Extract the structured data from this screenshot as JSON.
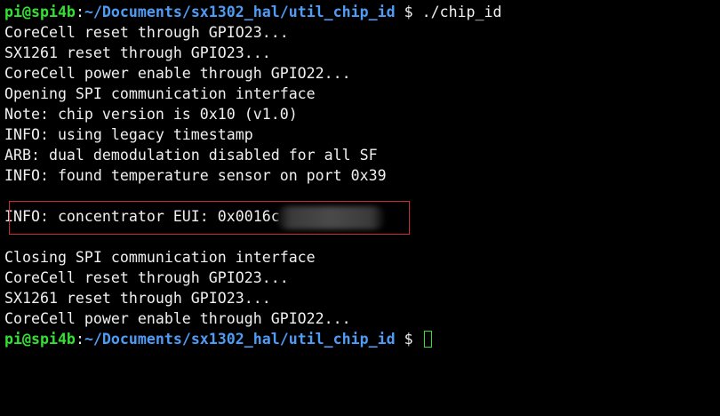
{
  "prompt": {
    "user_host": "pi@spi4b",
    "separator": ":",
    "path": "~/Documents/sx1302_hal/util_chip_id",
    "symbol": " $ ",
    "command": "./chip_id"
  },
  "output_before": [
    "CoreCell reset through GPIO23...",
    "SX1261 reset through GPIO23...",
    "CoreCell power enable through GPIO22...",
    "Opening SPI communication interface",
    "Note: chip version is 0x10 (v1.0)",
    "INFO: using legacy timestamp",
    "ARB: dual demodulation disabled for all SF",
    "INFO: found temperature sensor on port 0x39"
  ],
  "eui_line": "INFO: concentrator EUI: 0x0016c",
  "output_after": [
    "Closing SPI communication interface",
    "CoreCell reset through GPIO23...",
    "SX1261 reset through GPIO23...",
    "CoreCell power enable through GPIO22..."
  ],
  "prompt2": {
    "user_host": "pi@spi4b",
    "separator": ":",
    "path": "~/Documents/sx1302_hal/util_chip_id",
    "symbol": " $ "
  },
  "colors": {
    "background": "#000000",
    "text": "#f0f0f0",
    "user_host": "#34e034",
    "path": "#4f9cf5",
    "highlight_box": "#cc2a35"
  }
}
